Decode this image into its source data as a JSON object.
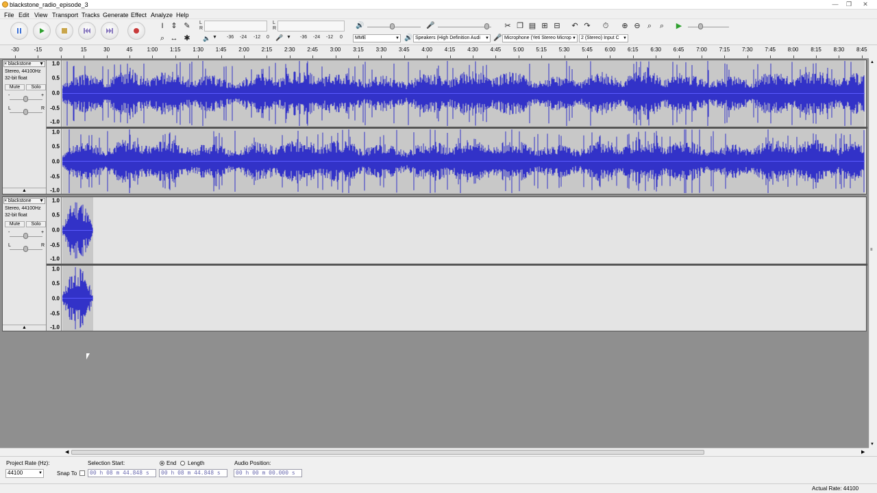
{
  "window": {
    "title": "blackstone_radio_episode_3",
    "minimize": "—",
    "maximize": "❐",
    "close": "✕"
  },
  "menu": [
    "File",
    "Edit",
    "View",
    "Transport",
    "Tracks",
    "Generate",
    "Effect",
    "Analyze",
    "Help"
  ],
  "transport": {
    "pause": "pause-icon",
    "play": "play-icon",
    "stop": "stop-icon",
    "skip_start": "skip-start-icon",
    "skip_end": "skip-end-icon",
    "record": "record-icon"
  },
  "meter": {
    "left": "L",
    "right": "R",
    "scale": [
      "-36",
      "-24",
      "-12",
      "0"
    ],
    "scale2": [
      "-36",
      "-24",
      "-12",
      "0"
    ]
  },
  "device": {
    "host": "MME",
    "output": "Speakers (High Definition Audi",
    "input": "Microphone (Yeti Stereo Microp",
    "channels": "2 (Stereo) Input C"
  },
  "ruler": [
    "-30",
    "-15",
    "0",
    "15",
    "30",
    "45",
    "1:00",
    "1:15",
    "1:30",
    "1:45",
    "2:00",
    "2:15",
    "2:30",
    "2:45",
    "3:00",
    "3:15",
    "3:30",
    "3:45",
    "4:00",
    "4:15",
    "4:30",
    "4:45",
    "5:00",
    "5:15",
    "5:30",
    "5:45",
    "6:00",
    "6:15",
    "6:30",
    "6:45",
    "7:00",
    "7:15",
    "7:30",
    "7:45",
    "8:00",
    "8:15",
    "8:30",
    "8:45"
  ],
  "tracks": [
    {
      "close": "×",
      "name": "blackstone",
      "info1": "Stereo, 44100Hz",
      "info2": "32-bit float",
      "mute": "Mute",
      "solo": "Solo",
      "gain_minus": "-",
      "gain_plus": "+",
      "pan_l": "L",
      "pan_r": "R",
      "collapse": "▲",
      "scale": [
        "1.0",
        "0.5",
        "0.0",
        "-0.5",
        "-1.0"
      ]
    },
    {
      "close": "×",
      "name": "blackstone",
      "info1": "Stereo, 44100Hz",
      "info2": "32-bit float",
      "mute": "Mute",
      "solo": "Solo",
      "gain_minus": "-",
      "gain_plus": "+",
      "pan_l": "L",
      "pan_r": "R",
      "collapse": "▲",
      "scale": [
        "1.0",
        "0.5",
        "0.0",
        "-0.5",
        "-1.0"
      ]
    }
  ],
  "selection": {
    "project_rate_label": "Project Rate (Hz):",
    "project_rate": "44100",
    "snap_to": "Snap To",
    "selection_start_label": "Selection Start:",
    "end_label": "End",
    "length_label": "Length",
    "audio_position_label": "Audio Position:",
    "start": "00 h 08 m 44.848 s",
    "end": "00 h 08 m 44.848 s",
    "position": "00 h 00 m 00.000 s"
  },
  "status": {
    "actual_rate": "Actual Rate: 44100"
  },
  "colors": {
    "waveform": "#3232c8",
    "track_bg": "#c8c8c8",
    "workspace": "#8f8f8f"
  }
}
